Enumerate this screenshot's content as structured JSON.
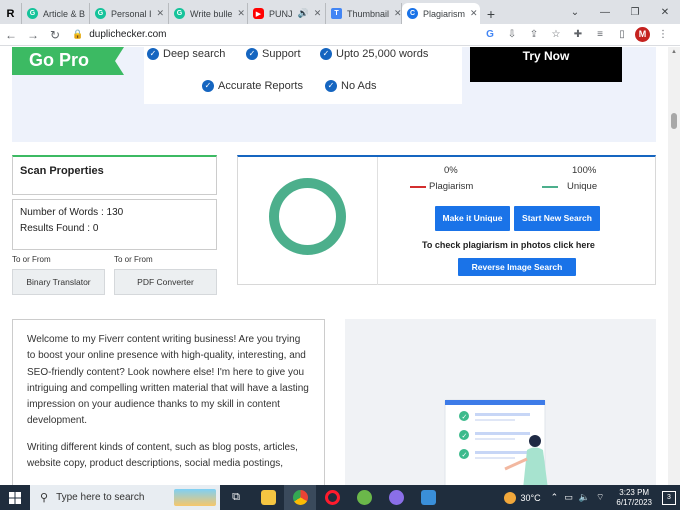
{
  "browser": {
    "tabs": [
      {
        "label": "Article & B",
        "icon": "grammarly-icon",
        "color": "#15c39a"
      },
      {
        "label": "Personal I",
        "icon": "grammarly-icon",
        "color": "#15c39a"
      },
      {
        "label": "Write bulle",
        "icon": "grammarly-icon",
        "color": "#15c39a"
      },
      {
        "label": "PUNJ",
        "icon": "youtube-icon",
        "color": "#ff0000"
      },
      {
        "label": "Thumbnail",
        "icon": "thumbnail-icon",
        "color": "#4285f4"
      },
      {
        "label": "Plagiarism",
        "icon": "duplichecker-icon",
        "color": "#1a73e8"
      }
    ],
    "first_tab": "R",
    "url": "duplichecker.com",
    "avatar_letter": "M"
  },
  "promo": {
    "go_pro": "Go Pro",
    "features": [
      "Deep search",
      "Support",
      "Upto 25,000 words",
      "Accurate Reports",
      "No Ads"
    ],
    "try_now": "Try Now"
  },
  "scan": {
    "title": "Scan Properties",
    "words_label": "Number of Words : 130",
    "results_label": "Results Found : 0"
  },
  "tools": {
    "to_or_from_1": "To or From",
    "to_or_from_2": "To or From",
    "binary_translator": "Binary Translator",
    "pdf_converter": "PDF Converter"
  },
  "result": {
    "plagiarism_pct": "0%",
    "unique_pct": "100%",
    "plagiarism_label": "Plagiarism",
    "unique_label": "Unique",
    "make_unique": "Make it Unique",
    "start_new": "Start New Search",
    "photo_text": "To check plagiarism in photos click here",
    "reverse_search": "Reverse Image Search",
    "plagiarism_color": "#d32f2f",
    "unique_color": "#4caf8c"
  },
  "content": {
    "para1": "Welcome to my Fiverr content writing business! Are you trying to boost your online presence with high-quality, interesting, and SEO-friendly content? Look nowhere else! I'm here to give you intriguing and compelling written material that will have a lasting impression on your audience thanks to my skill in content development.",
    "para2": "Writing different kinds of content, such as blog posts, articles, website copy, product descriptions, social media postings,"
  },
  "taskbar": {
    "search_placeholder": "Type here to search",
    "temperature": "30°C",
    "time": "3:23 PM",
    "date": "6/17/2023",
    "notifications": "3"
  }
}
